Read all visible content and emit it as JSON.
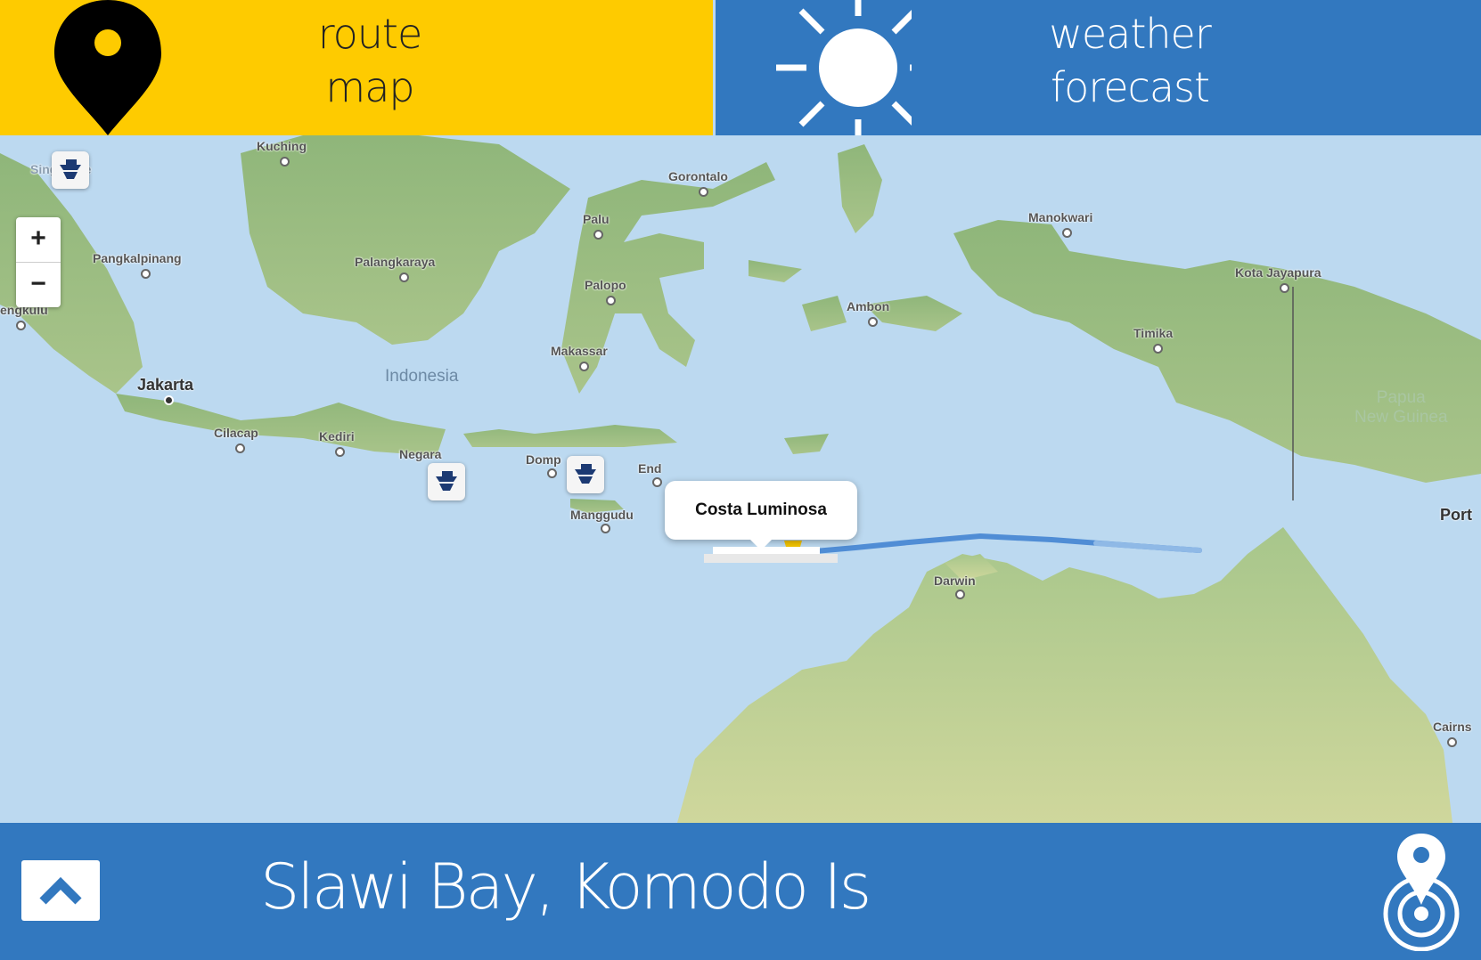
{
  "tabs": {
    "route": {
      "line1": "route",
      "line2": "map",
      "color": "#fecb00"
    },
    "weather": {
      "line1": "weather",
      "line2": "forecast",
      "color": "#3278bf"
    }
  },
  "map": {
    "zoom_in": "+",
    "zoom_out": "−",
    "popup_label": "Costa Luminosa",
    "regions": {
      "indonesia": "Indonesia",
      "papua_line1": "Papua",
      "papua_line2": "New Guinea"
    },
    "cities": {
      "kuching": "Kuching",
      "singapore": "Singapore",
      "gorontalo": "Gorontalo",
      "palu": "Palu",
      "manokwari": "Manokwari",
      "pangkalpinang": "Pangkalpinang",
      "palangkaraya": "Palangkaraya",
      "palopo": "Palopo",
      "kota_jayapura": "Kota Jayapura",
      "bengkulu": "engkulu",
      "ambon": "Ambon",
      "timika": "Timika",
      "makassar": "Makassar",
      "jakarta": "Jakarta",
      "cilacap": "Cilacap",
      "kediri": "Kediri",
      "negara": "Negara",
      "dompu": "Domp",
      "ende": "End",
      "manggudu": "Manggudu",
      "darwin": "Darwin",
      "port": "Port",
      "cairns": "Cairns"
    },
    "icons": {
      "port_marker": "ship-icon",
      "current_ship": "cruise-ship-icon"
    }
  },
  "bottom_bar": {
    "location": "Slawi Bay, Komodo Is",
    "up_icon": "chevron-up-icon",
    "locate_icon": "locate-icon"
  }
}
